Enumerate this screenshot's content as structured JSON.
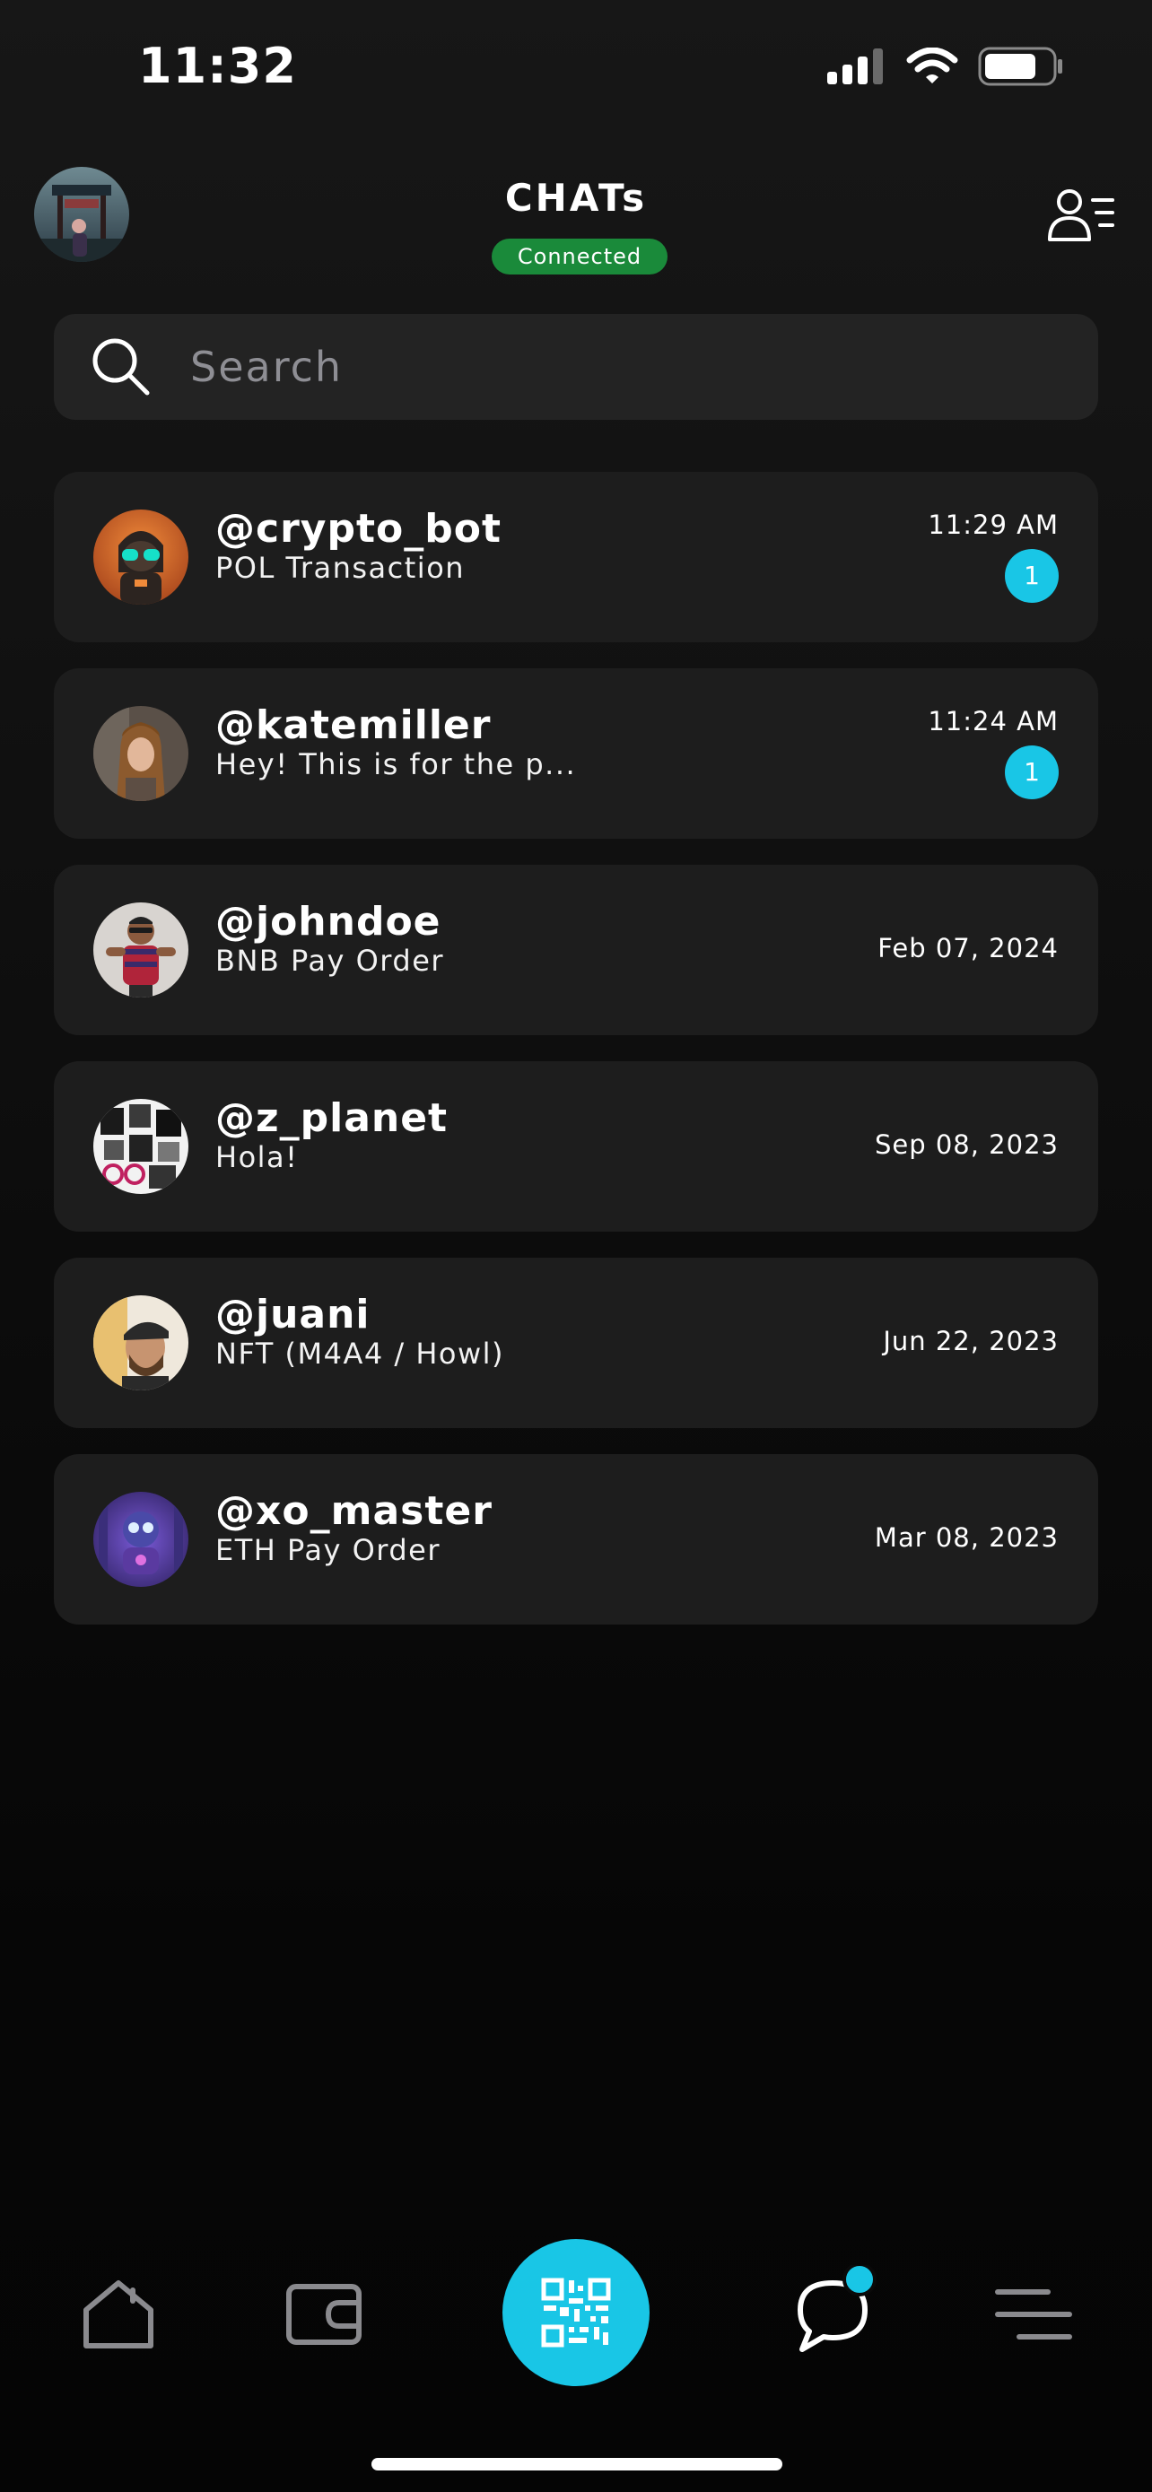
{
  "status_bar": {
    "time": "11:32",
    "signal_icon": "signal-icon",
    "wifi_icon": "wifi-icon",
    "battery_icon": "battery-icon"
  },
  "header": {
    "title": "CHATs",
    "connection_status": "Connected",
    "status_color": "#1a8a3a",
    "profile_icon": "profile-avatar",
    "contacts_icon": "contacts-list-icon"
  },
  "search": {
    "placeholder": "Search",
    "icon": "search-icon"
  },
  "chats": [
    {
      "name": "@crypto_bot",
      "preview": "POL Transaction",
      "time": "11:29 AM",
      "unread": "1"
    },
    {
      "name": "@katemiller",
      "preview": "Hey! This is for the p...",
      "time": "11:24 AM",
      "unread": "1"
    },
    {
      "name": "@johndoe",
      "preview": "BNB Pay Order",
      "time": "Feb 07, 2024"
    },
    {
      "name": "@z_planet",
      "preview": "Hola!",
      "time": "Sep 08, 2023"
    },
    {
      "name": "@juani",
      "preview": "NFT (M4A4 / Howl)",
      "time": "Jun 22, 2023"
    },
    {
      "name": "@xo_master",
      "preview": "ETH Pay Order",
      "time": "Mar 08, 2023"
    }
  ],
  "bottom_nav": {
    "items": [
      "home-icon",
      "wallet-icon",
      "qr-scan-icon",
      "chat-bubble-icon",
      "menu-icon"
    ],
    "accent_color": "#19c6e6"
  }
}
